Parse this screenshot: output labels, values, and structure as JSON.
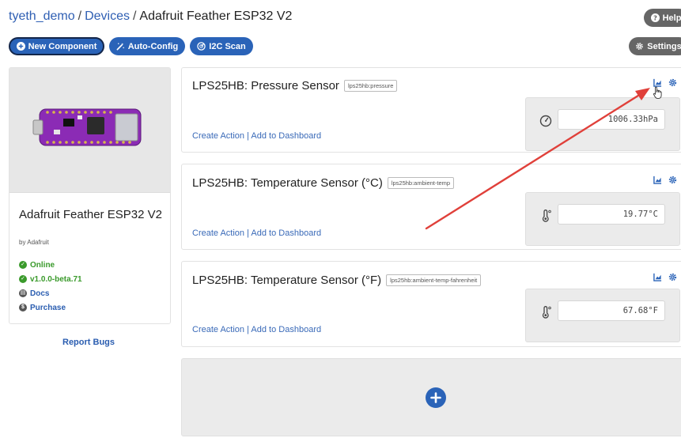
{
  "breadcrumb": {
    "user": "tyeth_demo",
    "separator": "/",
    "devices": "Devices",
    "current": "Adafruit Feather ESP32 V2"
  },
  "toolbar": {
    "new_component": "New Component",
    "auto_config": "Auto-Config",
    "i2c_scan": "I2C Scan",
    "help": "Help",
    "settings": "Settings"
  },
  "device": {
    "name": "Adafruit Feather ESP32 V2",
    "by": "by Adafruit",
    "status": "Online",
    "version": "v1.0.0-beta.71",
    "docs": "Docs",
    "purchase": "Purchase",
    "report_bugs": "Report Bugs"
  },
  "components": [
    {
      "title": "LPS25HB: Pressure Sensor",
      "key": "lps25hb:pressure",
      "create_action": "Create Action",
      "divider": "|",
      "add_to_dashboard": "Add to Dashboard",
      "value": "1006.33hPa",
      "icon": "gauge-icon"
    },
    {
      "title": "LPS25HB: Temperature Sensor (°C)",
      "key": "lps25hb:ambient-temp",
      "create_action": "Create Action",
      "divider": "|",
      "add_to_dashboard": "Add to Dashboard",
      "value": "19.77°C",
      "icon": "thermometer-icon"
    },
    {
      "title": "LPS25HB: Temperature Sensor (°F)",
      "key": "lps25hb:ambient-temp-fahrenheit",
      "create_action": "Create Action",
      "divider": "|",
      "add_to_dashboard": "Add to Dashboard",
      "value": "67.68°F",
      "icon": "thermometer-icon"
    }
  ],
  "colors": {
    "primary": "#2a63b8",
    "online": "#3a9a2b",
    "link": "#2a5db0",
    "annotation_arrow": "#e0403a"
  }
}
